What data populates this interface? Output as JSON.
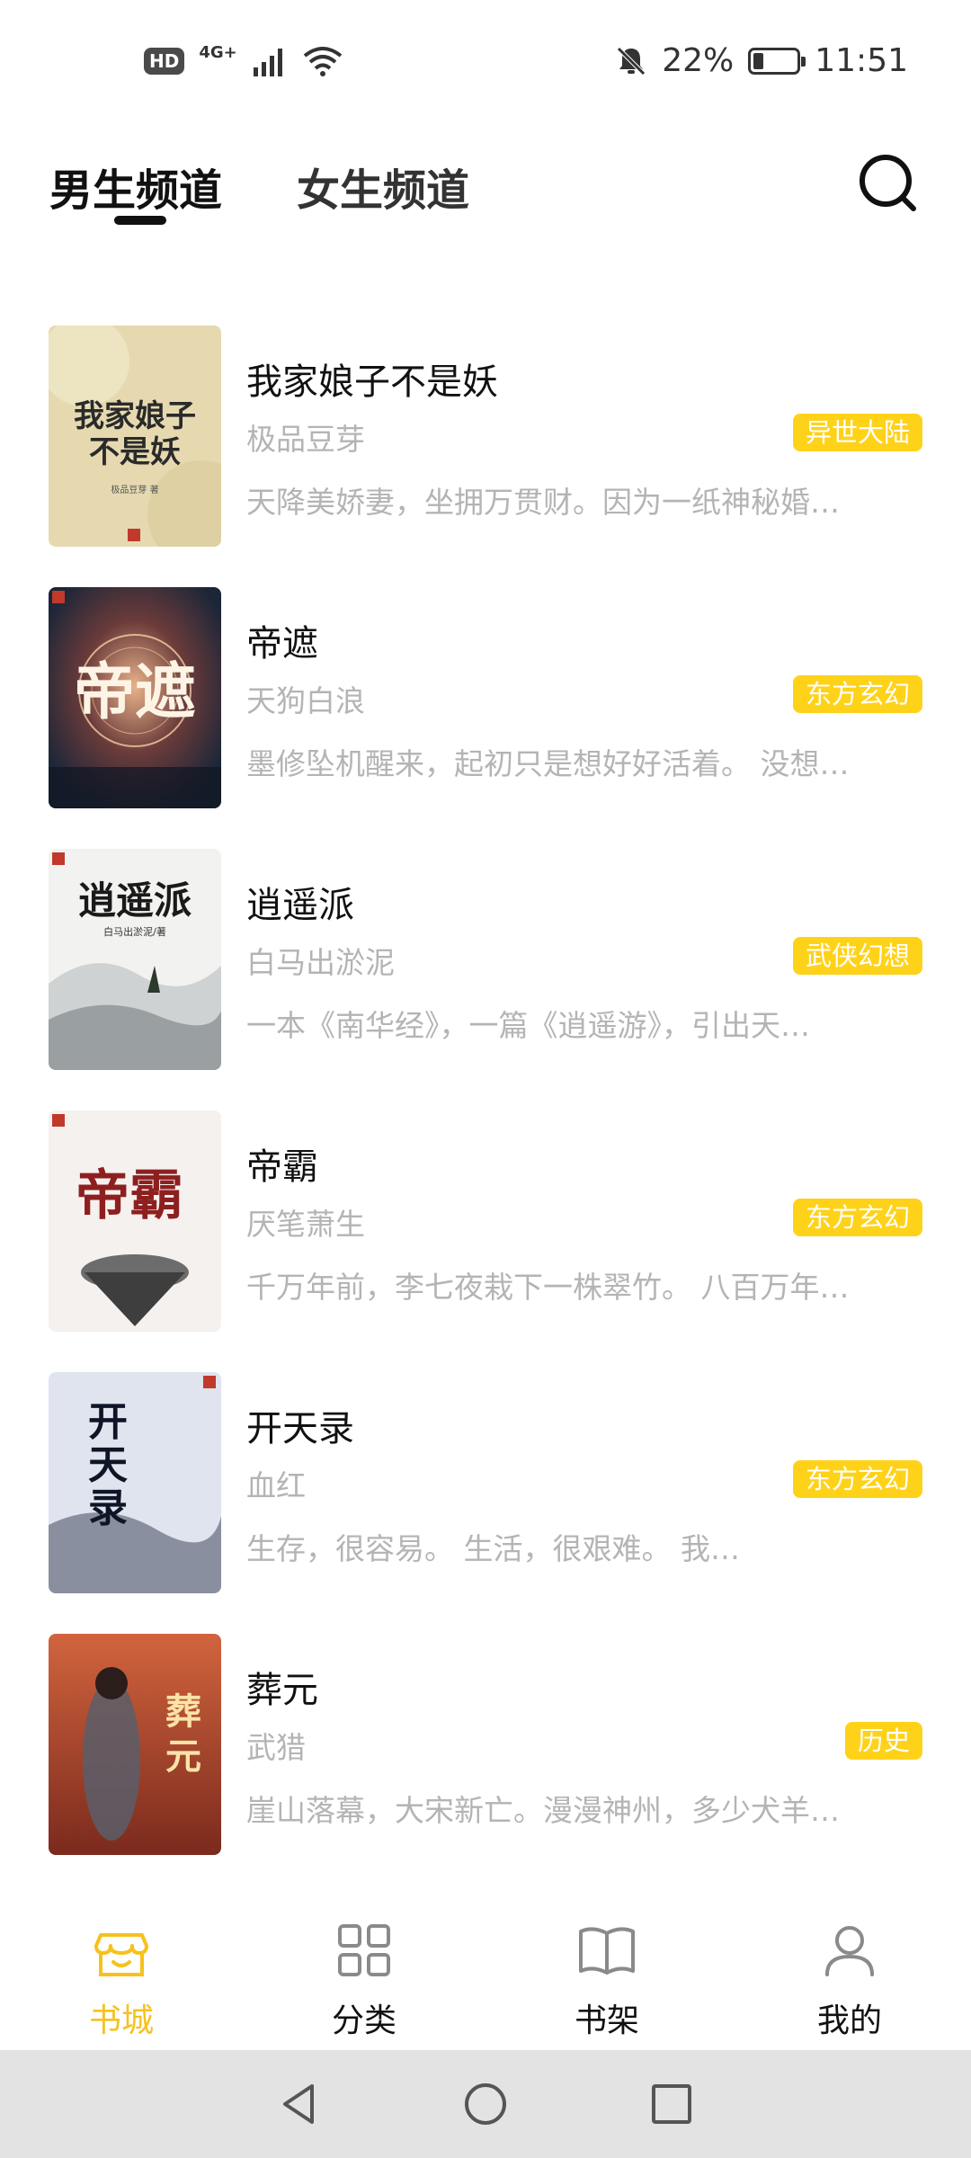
{
  "status_bar": {
    "hd": "HD",
    "network": "4G+",
    "battery": "22%",
    "battery_level": 0.22,
    "time": "11:51"
  },
  "header": {
    "tabs": [
      {
        "label": "男生频道",
        "active": true
      },
      {
        "label": "女生频道",
        "active": false
      }
    ]
  },
  "books": [
    {
      "title": "我家娘子不是妖",
      "author": "极品豆芽",
      "tag": "异世大陆",
      "desc": "天降美娇妻，坐拥万贯财。因为一纸神秘婚…",
      "cover_text": "我家娘子不是妖",
      "cover_author": "极品豆芽 著"
    },
    {
      "title": "帝遮",
      "author": "天狗白浪",
      "tag": "东方玄幻",
      "desc": "墨修坠机醒来，起初只是想好好活着。 没想…",
      "cover_text": "帝遮"
    },
    {
      "title": "逍遥派",
      "author": "白马出淤泥",
      "tag": "武侠幻想",
      "desc": "一本《南华经》，一篇《逍遥游》，引出天…",
      "cover_text": "逍遥派",
      "cover_author": "白马出淤泥/著"
    },
    {
      "title": "帝霸",
      "author": "厌笔萧生",
      "tag": "东方玄幻",
      "desc": "千万年前，李七夜栽下一株翠竹。 八百万年…",
      "cover_text": "帝霸"
    },
    {
      "title": "开天录",
      "author": "血红",
      "tag": "东方玄幻",
      "desc": "生存，很容易。        生活，很艰难。        我…",
      "cover_text": "开天录"
    },
    {
      "title": "葬元",
      "author": "武猎",
      "tag": "历史",
      "desc": "崖山落幕，大宋新亡。漫漫神州，多少犬羊…",
      "cover_text": "葬元"
    }
  ],
  "bottom_nav": [
    {
      "label": "书城",
      "icon": "store-icon",
      "active": true
    },
    {
      "label": "分类",
      "icon": "grid-icon",
      "active": false
    },
    {
      "label": "书架",
      "icon": "book-open-icon",
      "active": false
    },
    {
      "label": "我的",
      "icon": "user-icon",
      "active": false
    }
  ],
  "colors": {
    "accent": "#ffd21a",
    "nav_active": "#f6c21b",
    "muted_text": "#b4b4b4"
  }
}
